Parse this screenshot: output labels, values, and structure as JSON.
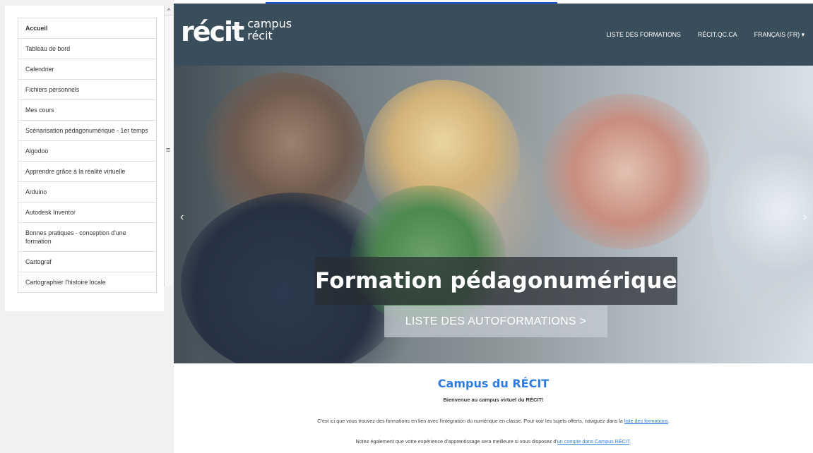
{
  "header": {
    "logo_main": "récit",
    "logo_line1": "campus",
    "logo_line2": "récit",
    "nav": [
      {
        "label": "LISTE DES FORMATIONS"
      },
      {
        "label": "RÉCIT.QC.CA"
      },
      {
        "label": "FRANÇAIS (FR) ▾"
      }
    ]
  },
  "drawer": {
    "scroll_up": "^",
    "handle": "≡",
    "items": [
      {
        "label": "Accueil",
        "style": "bold"
      },
      {
        "label": "Tableau de bord"
      },
      {
        "label": "Calendrier"
      },
      {
        "label": "Fichiers personnels"
      },
      {
        "label": "Mes cours"
      },
      {
        "label": "Scénarisation pédagonumérique - 1er temps"
      },
      {
        "label": "Algodoo"
      },
      {
        "label": "Apprendre grâce à la réalité virtuelle"
      },
      {
        "label": "Arduino"
      },
      {
        "label": "Autodesk Inventor"
      },
      {
        "label": "Bonnes pratiques - conception d'une formation"
      },
      {
        "label": "Cartograf"
      },
      {
        "label": "Cartographier l'histoire locale"
      }
    ]
  },
  "hero": {
    "arrow_left": "‹",
    "arrow_right": "›",
    "title": "Formation pédagonumérique",
    "cta": "LISTE DES AUTOFORMATIONS >"
  },
  "content": {
    "title": "Campus du RÉCIT",
    "subtitle": "Bienvenue au campus virtuel du RÉCIT!",
    "intro1_before": "C'est ici que vous trouvez des formations en lien avec l'intégration du numérique en classe. Pour voir les sujets offerts, naviguez dans la ",
    "intro1_link": "liste des formations",
    "intro1_after": ".",
    "intro2_before": "Notez également que votre expérience d'apprentissage sera meilleure si vous disposez d'",
    "intro2_link": "un compte dans Campus RÉCIT",
    "intro2_after": "."
  },
  "colors": {
    "header_bg": "#394d5a",
    "accent_blue": "#2f7ce0",
    "drawer_bg": "#f1f1f1"
  }
}
